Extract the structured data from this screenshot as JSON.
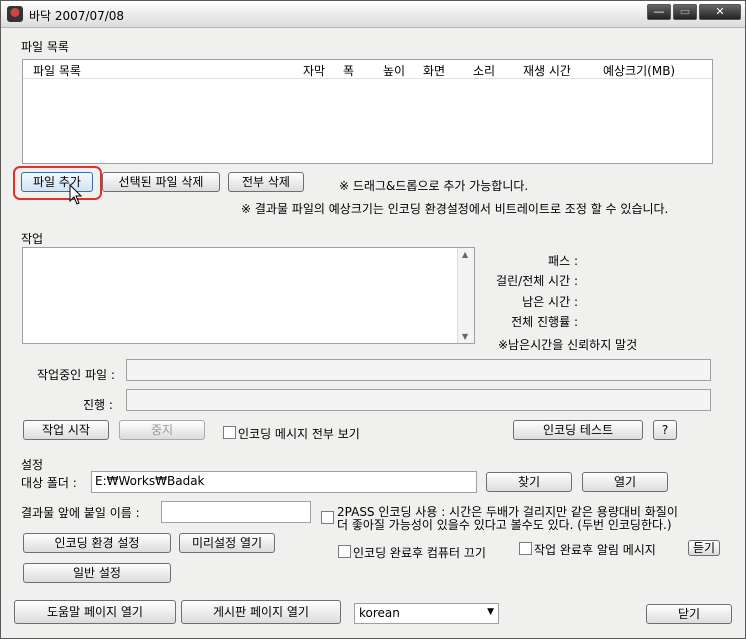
{
  "window": {
    "title": "바닥 2007/07/08",
    "min": "—",
    "max": "▭",
    "close": "✕"
  },
  "file_list": {
    "section_label": "파일 목록",
    "columns": [
      "파일 목록",
      "자막",
      "폭",
      "높이",
      "화면",
      "소리",
      "재생 시간",
      "예상크기(MB)"
    ]
  },
  "file_buttons": {
    "add": "파일 추가",
    "delete_selected": "선택된 파일 삭제",
    "delete_all": "전부 삭제"
  },
  "notes": {
    "drag_drop": "※ 드래그&드롭으로 추가 가능합니다.",
    "size_note": "※ 결과물 파일의 예상크기는 인코딩 환경설정에서 비트레이트로 조정 할 수 있습니다."
  },
  "job": {
    "section_label": "작업",
    "pass": "패스 :",
    "elapsed_total": "걸린/전체 시간 :",
    "remaining": "남은 시간 :",
    "total_progress": "전체 진행률 :",
    "warning": "※남은시간을 신뢰하지 말것",
    "current_file": "작업중인 파일 :",
    "progress": "진행 :",
    "start": "작업 시작",
    "stop": "중지",
    "show_all_messages": "인코딩 메시지 전부 보기",
    "encoding_test": "인코딩 테스트",
    "help_q": "?"
  },
  "settings": {
    "section_label": "설정",
    "target_folder_label": "대상 폴더 :",
    "target_folder_value": "E:₩Works₩Badak",
    "browse": "찾기",
    "open": "열기",
    "prefix_label": "결과물 앞에 붙일 이름 :",
    "prefix_value": "",
    "twopass": "2PASS 인코딩 사용 : 시간은 두배가 걸리지만 같은 용량대비 화질이",
    "twopass_line2": "더 좋아질 가능성이 있을수 있다고 볼수도 있다. (두번 인코딩한다.)",
    "encoding_env": "인코딩 환경 설정",
    "open_presets": "미리설정 열기",
    "shutdown_after": "인코딩 완료후 컴퓨터 끄기",
    "notify_after": "작업 완료후 알림 메시지",
    "listen": "듣기",
    "general_settings": "일반 설정"
  },
  "bottom": {
    "help_page": "도움말 페이지 열기",
    "board_page": "게시판 페이지 열기",
    "language": "korean",
    "close": "닫기"
  }
}
